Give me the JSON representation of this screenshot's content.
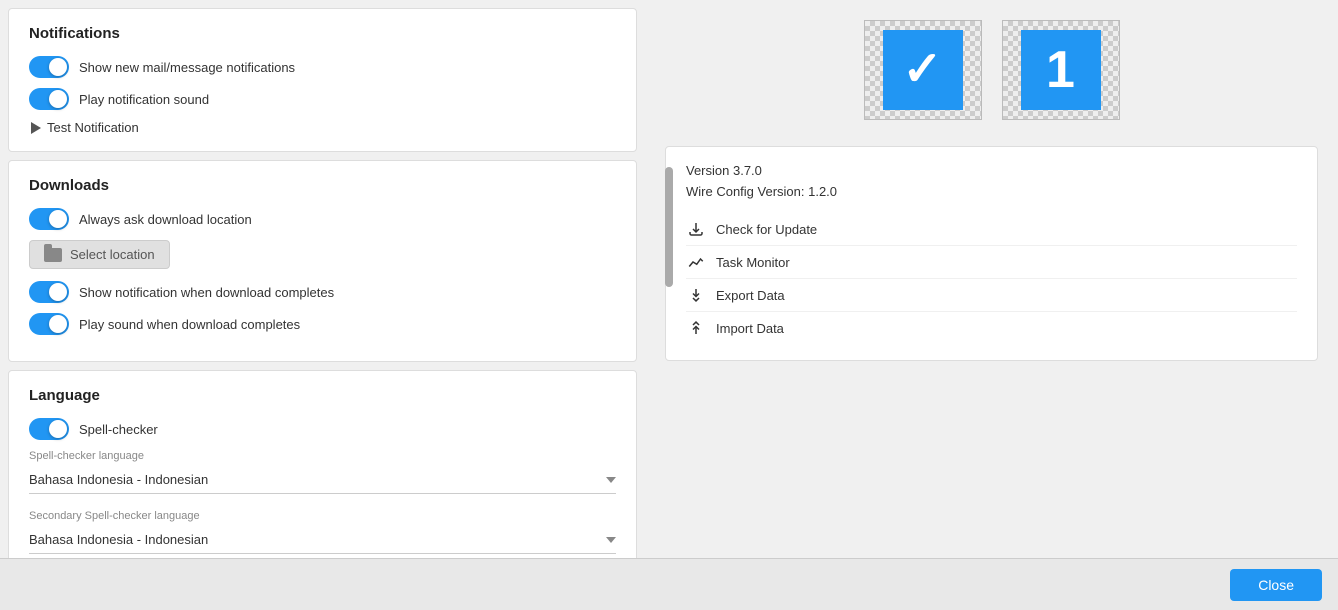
{
  "notifications": {
    "title": "Notifications",
    "toggles": [
      {
        "id": "show-mail",
        "label": "Show new mail/message notifications",
        "enabled": true
      },
      {
        "id": "play-sound",
        "label": "Play notification sound",
        "enabled": true
      }
    ],
    "test_notification_label": "Test Notification"
  },
  "downloads": {
    "title": "Downloads",
    "toggles": [
      {
        "id": "ask-location",
        "label": "Always ask download location",
        "enabled": true
      },
      {
        "id": "show-notif",
        "label": "Show notification when download completes",
        "enabled": true
      },
      {
        "id": "play-sound",
        "label": "Play sound when download completes",
        "enabled": true
      }
    ],
    "select_location_label": "Select location"
  },
  "language": {
    "title": "Language",
    "spell_checker_toggle_label": "Spell-checker",
    "spell_checker_enabled": true,
    "spell_checker_language_label": "Spell-checker language",
    "spell_checker_language_value": "Bahasa Indonesia - Indonesian",
    "secondary_spell_checker_label": "Secondary Spell-checker language",
    "secondary_spell_checker_value": "Bahasa Indonesia - Indonesian"
  },
  "right_panel": {
    "app_icons": [
      {
        "id": "checkbox-icon",
        "symbol": "✓"
      },
      {
        "id": "number-icon",
        "symbol": "1"
      }
    ],
    "version": "Version 3.7.0",
    "config_version": "Wire Config Version: 1.2.0",
    "actions": [
      {
        "id": "check-update",
        "label": "Check for Update",
        "icon": "download-icon"
      },
      {
        "id": "task-monitor",
        "label": "Task Monitor",
        "icon": "chart-icon"
      },
      {
        "id": "export-data",
        "label": "Export Data",
        "icon": "export-icon"
      },
      {
        "id": "import-data",
        "label": "Import Data",
        "icon": "import-icon"
      }
    ]
  },
  "footer": {
    "close_label": "Close"
  }
}
